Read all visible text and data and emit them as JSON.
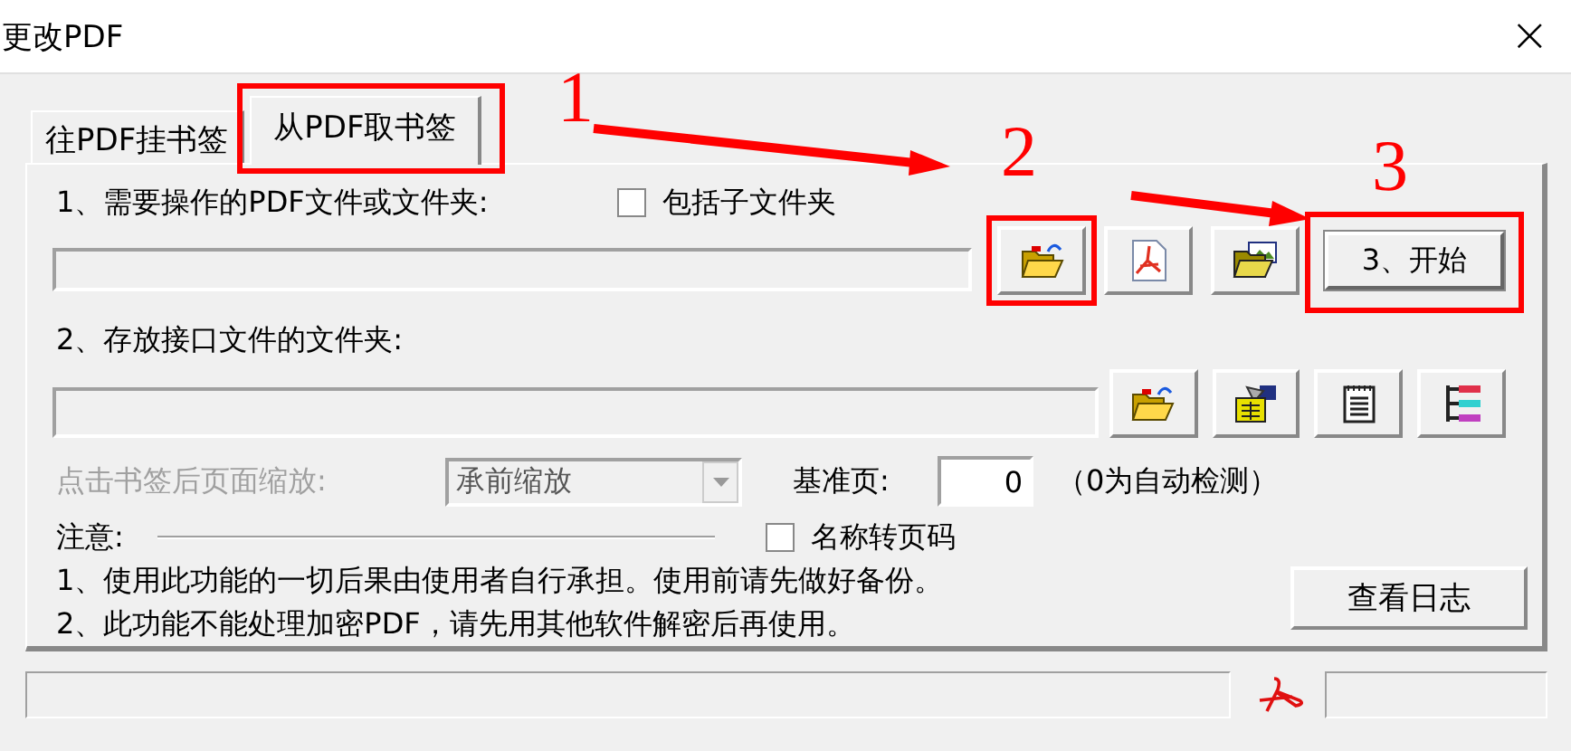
{
  "window": {
    "title": "更改PDF",
    "close": "×"
  },
  "tabs": [
    {
      "label": "往PDF挂书签",
      "selected": false,
      "highlighted": false
    },
    {
      "label": "从PDF取书签",
      "selected": true,
      "highlighted": true
    }
  ],
  "source": {
    "label": "1、需要操作的PDF文件或文件夹:",
    "subfolders": {
      "label": "包括子文件夹",
      "checked": false
    },
    "buttons": [
      {
        "kind": "folder-open",
        "highlighted": true
      },
      {
        "kind": "pdf",
        "highlighted": false
      },
      {
        "kind": "folder-image",
        "highlighted": false
      }
    ],
    "start_button": {
      "label": "3、开始",
      "highlighted": true
    }
  },
  "interface": {
    "label": "2、存放接口文件的文件夹:",
    "buttons": [
      {
        "kind": "folder-open"
      },
      {
        "kind": "settings-folder"
      },
      {
        "kind": "notepad"
      },
      {
        "kind": "tree"
      }
    ]
  },
  "zoom": {
    "label": "点击书签后页面缩放:",
    "disabled": true,
    "value": "承前缩放"
  },
  "base_page": {
    "label": "基准页:",
    "value": "0",
    "hint": "（0为自动检测）"
  },
  "name_to_page": {
    "label": "名称转页码",
    "checked": false
  },
  "notes": {
    "title": "注意:",
    "lines": [
      "1、使用此功能的一切后果由使用者自行承担。使用前请先做好备份。",
      "2、此功能不能处理加密PDF，请先用其他软件解密后再使用。"
    ]
  },
  "log_button": "查看日志",
  "annotations": [
    {
      "label": "1"
    },
    {
      "label": "2"
    },
    {
      "label": "3"
    }
  ]
}
